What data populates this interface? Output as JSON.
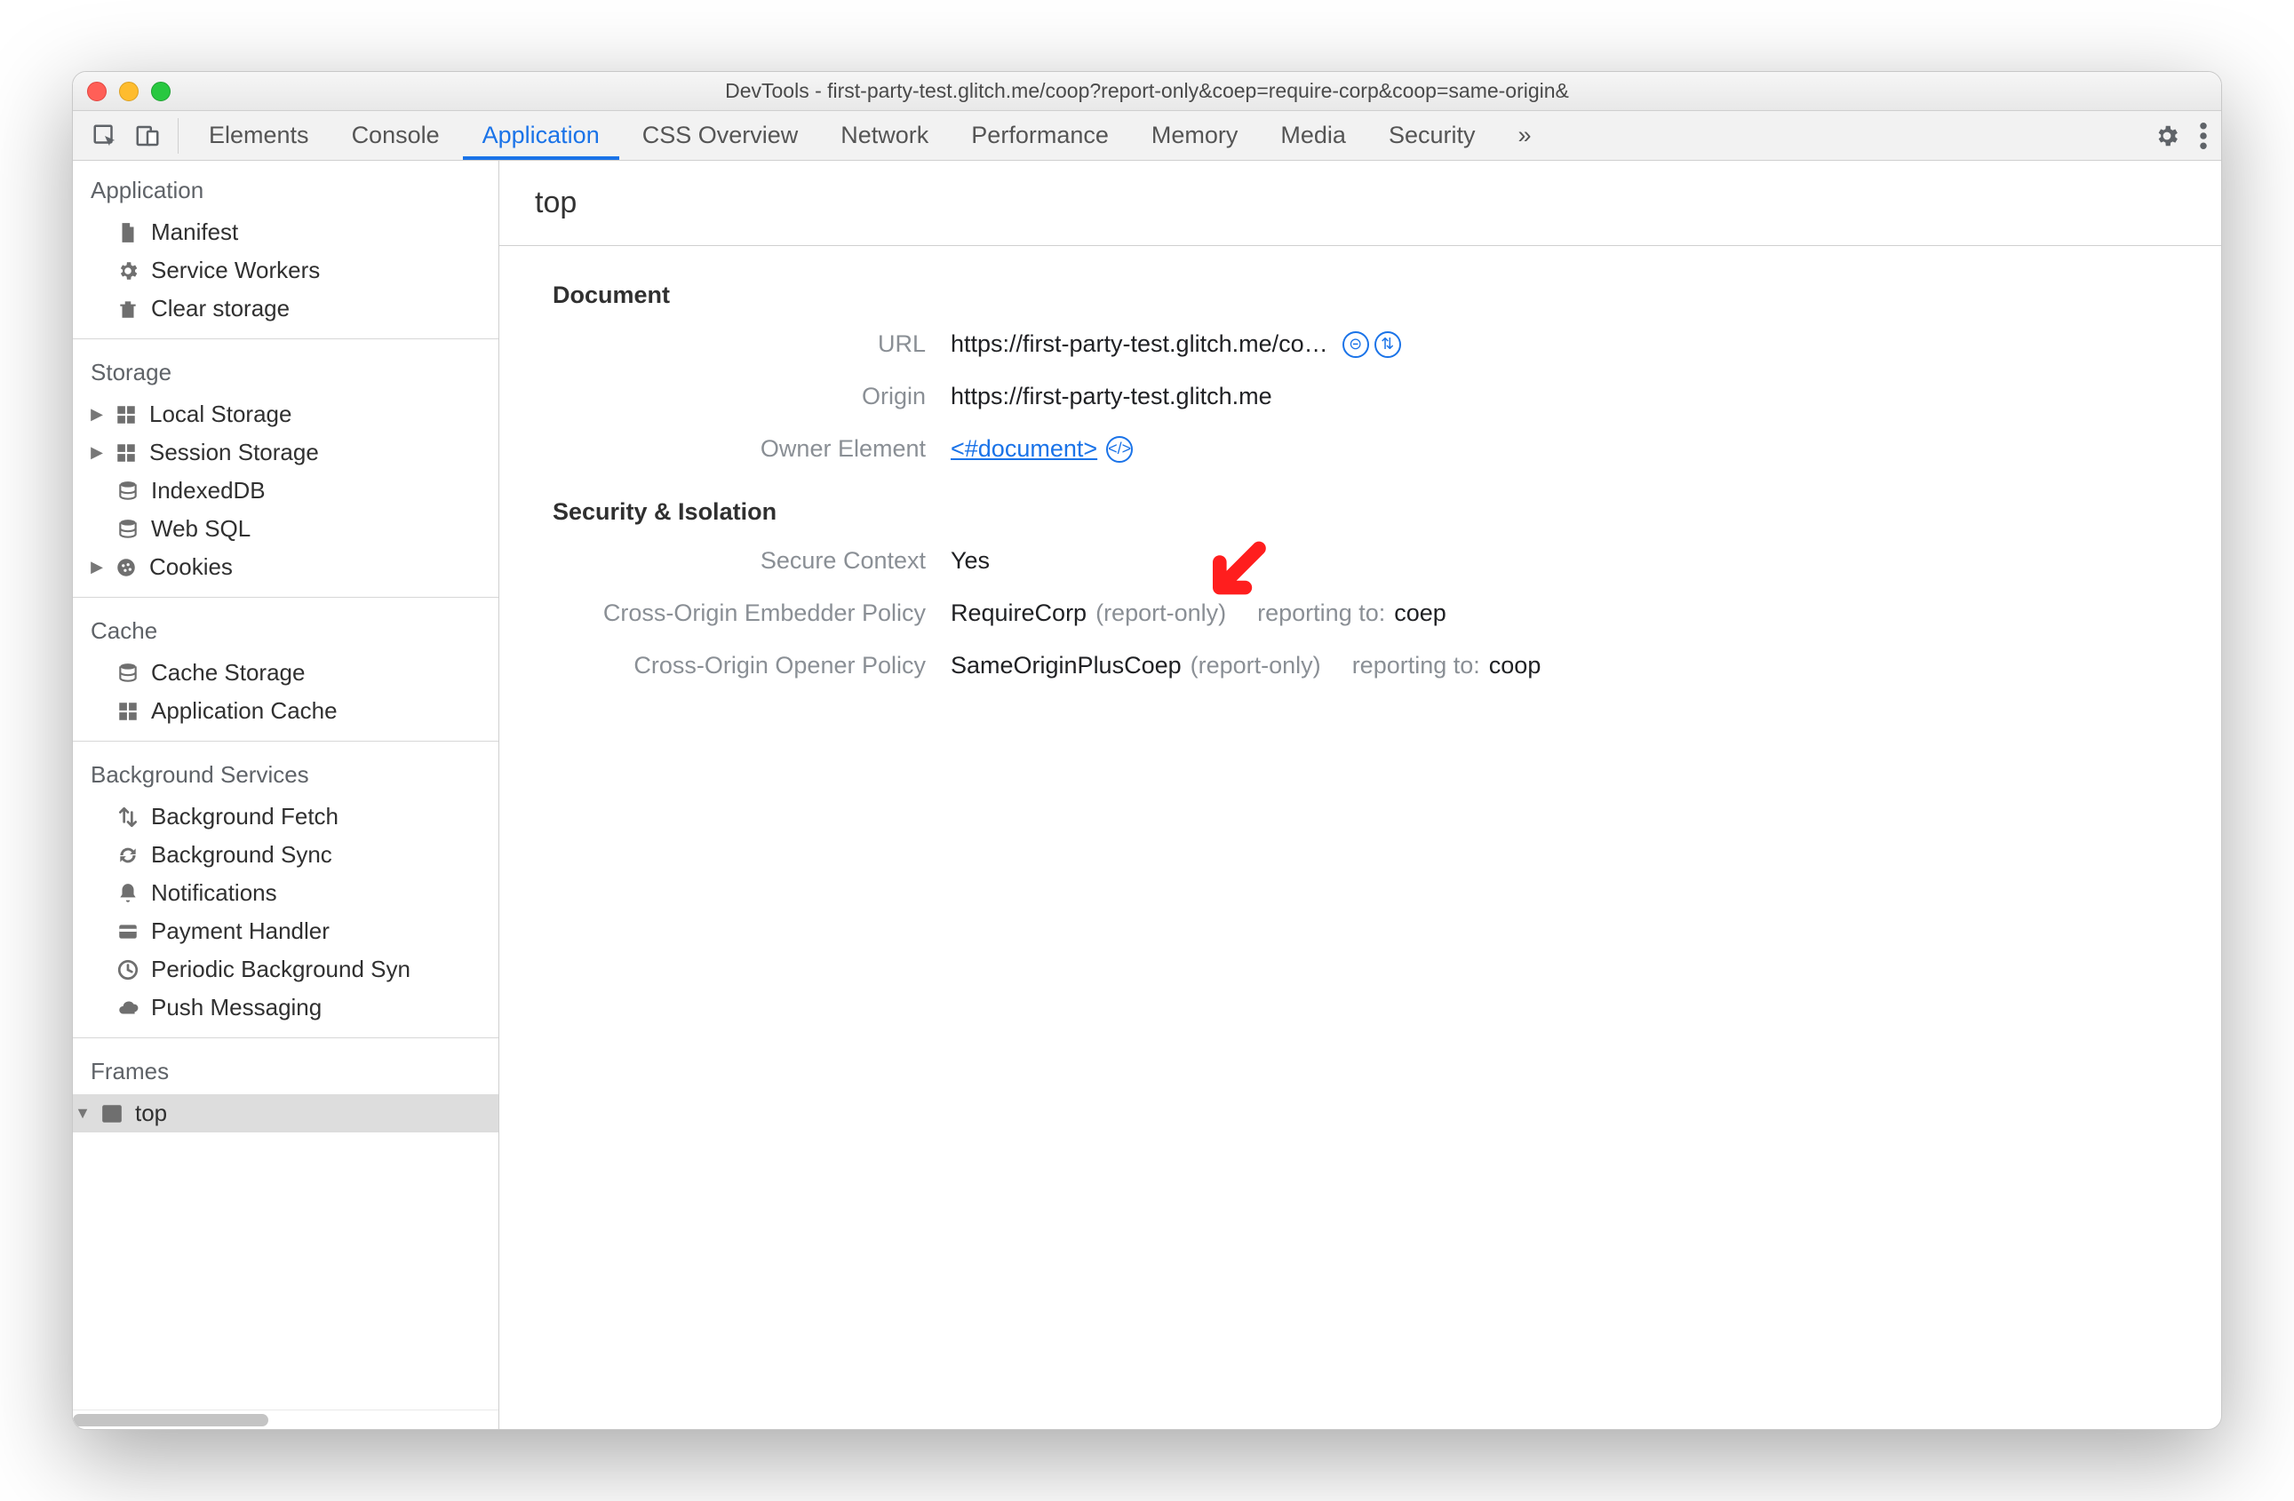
{
  "window": {
    "title": "DevTools - first-party-test.glitch.me/coop?report-only&coep=require-corp&coop=same-origin&"
  },
  "tabs": {
    "items": [
      "Elements",
      "Console",
      "Application",
      "CSS Overview",
      "Network",
      "Performance",
      "Memory",
      "Media",
      "Security"
    ],
    "active": "Application",
    "overflow": "»"
  },
  "sidebar": {
    "groups": [
      {
        "title": "Application",
        "items": [
          {
            "icon": "file",
            "label": "Manifest"
          },
          {
            "icon": "gear",
            "label": "Service Workers"
          },
          {
            "icon": "trash",
            "label": "Clear storage"
          }
        ]
      },
      {
        "title": "Storage",
        "items": [
          {
            "icon": "grid",
            "label": "Local Storage",
            "expandable": true
          },
          {
            "icon": "grid",
            "label": "Session Storage",
            "expandable": true
          },
          {
            "icon": "db",
            "label": "IndexedDB"
          },
          {
            "icon": "db",
            "label": "Web SQL"
          },
          {
            "icon": "cookie",
            "label": "Cookies",
            "expandable": true
          }
        ]
      },
      {
        "title": "Cache",
        "items": [
          {
            "icon": "db",
            "label": "Cache Storage"
          },
          {
            "icon": "grid",
            "label": "Application Cache"
          }
        ]
      },
      {
        "title": "Background Services",
        "items": [
          {
            "icon": "updown",
            "label": "Background Fetch"
          },
          {
            "icon": "sync",
            "label": "Background Sync"
          },
          {
            "icon": "bell",
            "label": "Notifications"
          },
          {
            "icon": "card",
            "label": "Payment Handler"
          },
          {
            "icon": "clock",
            "label": "Periodic Background Syn"
          },
          {
            "icon": "cloud",
            "label": "Push Messaging"
          }
        ]
      },
      {
        "title": "Frames",
        "items": [
          {
            "icon": "window",
            "label": "top",
            "expandable": true,
            "expanded": true,
            "selected": true
          }
        ]
      }
    ]
  },
  "main": {
    "heading": "top",
    "document": {
      "section_title": "Document",
      "url_label": "URL",
      "url_value": "https://first-party-test.glitch.me/co…",
      "origin_label": "Origin",
      "origin_value": "https://first-party-test.glitch.me",
      "owner_label": "Owner Element",
      "owner_link": "<#document>"
    },
    "security": {
      "section_title": "Security & Isolation",
      "secure_context_label": "Secure Context",
      "secure_context_value": "Yes",
      "coep_label": "Cross-Origin Embedder Policy",
      "coep_value": "RequireCorp",
      "coep_mode": "(report-only)",
      "coep_reporting_label": "reporting to:",
      "coep_reporting_value": "coep",
      "coop_label": "Cross-Origin Opener Policy",
      "coop_value": "SameOriginPlusCoep",
      "coop_mode": "(report-only)",
      "coop_reporting_label": "reporting to:",
      "coop_reporting_value": "coop"
    }
  }
}
